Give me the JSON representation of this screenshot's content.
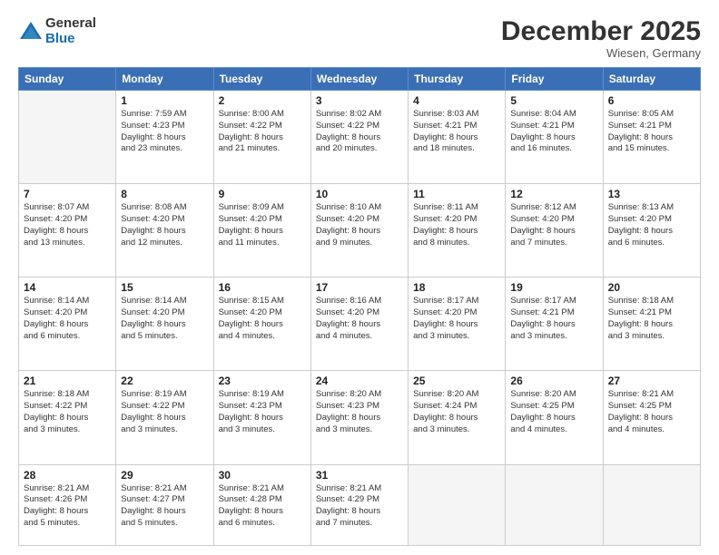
{
  "header": {
    "logo_general": "General",
    "logo_blue": "Blue",
    "month_title": "December 2025",
    "location": "Wiesen, Germany"
  },
  "days_of_week": [
    "Sunday",
    "Monday",
    "Tuesday",
    "Wednesday",
    "Thursday",
    "Friday",
    "Saturday"
  ],
  "weeks": [
    [
      {
        "day": "",
        "info": ""
      },
      {
        "day": "1",
        "info": "Sunrise: 7:59 AM\nSunset: 4:23 PM\nDaylight: 8 hours\nand 23 minutes."
      },
      {
        "day": "2",
        "info": "Sunrise: 8:00 AM\nSunset: 4:22 PM\nDaylight: 8 hours\nand 21 minutes."
      },
      {
        "day": "3",
        "info": "Sunrise: 8:02 AM\nSunset: 4:22 PM\nDaylight: 8 hours\nand 20 minutes."
      },
      {
        "day": "4",
        "info": "Sunrise: 8:03 AM\nSunset: 4:21 PM\nDaylight: 8 hours\nand 18 minutes."
      },
      {
        "day": "5",
        "info": "Sunrise: 8:04 AM\nSunset: 4:21 PM\nDaylight: 8 hours\nand 16 minutes."
      },
      {
        "day": "6",
        "info": "Sunrise: 8:05 AM\nSunset: 4:21 PM\nDaylight: 8 hours\nand 15 minutes."
      }
    ],
    [
      {
        "day": "7",
        "info": "Sunrise: 8:07 AM\nSunset: 4:20 PM\nDaylight: 8 hours\nand 13 minutes."
      },
      {
        "day": "8",
        "info": "Sunrise: 8:08 AM\nSunset: 4:20 PM\nDaylight: 8 hours\nand 12 minutes."
      },
      {
        "day": "9",
        "info": "Sunrise: 8:09 AM\nSunset: 4:20 PM\nDaylight: 8 hours\nand 11 minutes."
      },
      {
        "day": "10",
        "info": "Sunrise: 8:10 AM\nSunset: 4:20 PM\nDaylight: 8 hours\nand 9 minutes."
      },
      {
        "day": "11",
        "info": "Sunrise: 8:11 AM\nSunset: 4:20 PM\nDaylight: 8 hours\nand 8 minutes."
      },
      {
        "day": "12",
        "info": "Sunrise: 8:12 AM\nSunset: 4:20 PM\nDaylight: 8 hours\nand 7 minutes."
      },
      {
        "day": "13",
        "info": "Sunrise: 8:13 AM\nSunset: 4:20 PM\nDaylight: 8 hours\nand 6 minutes."
      }
    ],
    [
      {
        "day": "14",
        "info": "Sunrise: 8:14 AM\nSunset: 4:20 PM\nDaylight: 8 hours\nand 6 minutes."
      },
      {
        "day": "15",
        "info": "Sunrise: 8:14 AM\nSunset: 4:20 PM\nDaylight: 8 hours\nand 5 minutes."
      },
      {
        "day": "16",
        "info": "Sunrise: 8:15 AM\nSunset: 4:20 PM\nDaylight: 8 hours\nand 4 minutes."
      },
      {
        "day": "17",
        "info": "Sunrise: 8:16 AM\nSunset: 4:20 PM\nDaylight: 8 hours\nand 4 minutes."
      },
      {
        "day": "18",
        "info": "Sunrise: 8:17 AM\nSunset: 4:20 PM\nDaylight: 8 hours\nand 3 minutes."
      },
      {
        "day": "19",
        "info": "Sunrise: 8:17 AM\nSunset: 4:21 PM\nDaylight: 8 hours\nand 3 minutes."
      },
      {
        "day": "20",
        "info": "Sunrise: 8:18 AM\nSunset: 4:21 PM\nDaylight: 8 hours\nand 3 minutes."
      }
    ],
    [
      {
        "day": "21",
        "info": "Sunrise: 8:18 AM\nSunset: 4:22 PM\nDaylight: 8 hours\nand 3 minutes."
      },
      {
        "day": "22",
        "info": "Sunrise: 8:19 AM\nSunset: 4:22 PM\nDaylight: 8 hours\nand 3 minutes."
      },
      {
        "day": "23",
        "info": "Sunrise: 8:19 AM\nSunset: 4:23 PM\nDaylight: 8 hours\nand 3 minutes."
      },
      {
        "day": "24",
        "info": "Sunrise: 8:20 AM\nSunset: 4:23 PM\nDaylight: 8 hours\nand 3 minutes."
      },
      {
        "day": "25",
        "info": "Sunrise: 8:20 AM\nSunset: 4:24 PM\nDaylight: 8 hours\nand 3 minutes."
      },
      {
        "day": "26",
        "info": "Sunrise: 8:20 AM\nSunset: 4:25 PM\nDaylight: 8 hours\nand 4 minutes."
      },
      {
        "day": "27",
        "info": "Sunrise: 8:21 AM\nSunset: 4:25 PM\nDaylight: 8 hours\nand 4 minutes."
      }
    ],
    [
      {
        "day": "28",
        "info": "Sunrise: 8:21 AM\nSunset: 4:26 PM\nDaylight: 8 hours\nand 5 minutes."
      },
      {
        "day": "29",
        "info": "Sunrise: 8:21 AM\nSunset: 4:27 PM\nDaylight: 8 hours\nand 5 minutes."
      },
      {
        "day": "30",
        "info": "Sunrise: 8:21 AM\nSunset: 4:28 PM\nDaylight: 8 hours\nand 6 minutes."
      },
      {
        "day": "31",
        "info": "Sunrise: 8:21 AM\nSunset: 4:29 PM\nDaylight: 8 hours\nand 7 minutes."
      },
      {
        "day": "",
        "info": ""
      },
      {
        "day": "",
        "info": ""
      },
      {
        "day": "",
        "info": ""
      }
    ]
  ]
}
